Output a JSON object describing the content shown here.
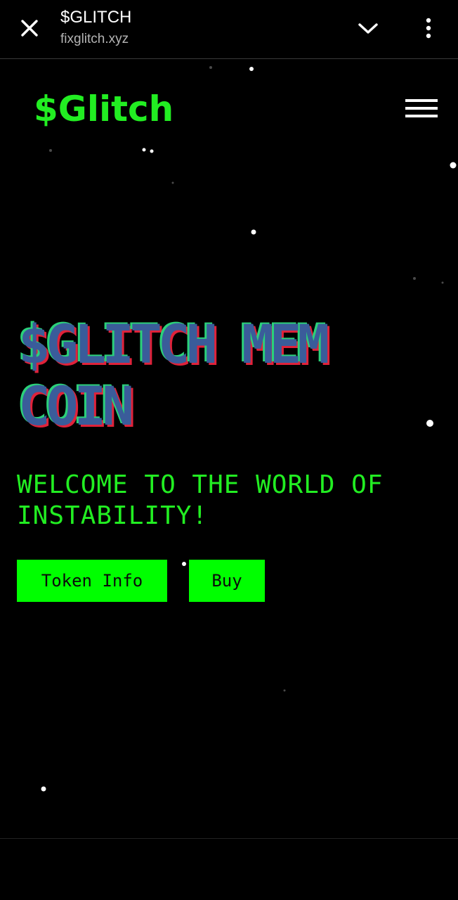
{
  "browser": {
    "title": "$GLITCH",
    "url": "fixglitch.xyz",
    "icons": {
      "close": "close-icon",
      "collapse": "chevron-down-icon",
      "more": "more-vertical-icon"
    }
  },
  "site": {
    "logo": "$Glitch",
    "menu_icon": "hamburger-menu-icon",
    "hero": {
      "title_lines": [
        "$GLITCH MEM",
        "COIN"
      ]
    },
    "subtitle_lines": [
      "WELCOME TO THE WORLD OF",
      "INSTABILITY!"
    ],
    "buttons": {
      "token_info": "Token Info",
      "buy": "Buy"
    }
  },
  "colors": {
    "background": "#000000",
    "logo_green": "#22ee22",
    "button_green": "#00ff00",
    "hero_blue": "#3a5c9a",
    "glitch_cyan": "#2bd17a",
    "glitch_red": "#e0223a"
  }
}
